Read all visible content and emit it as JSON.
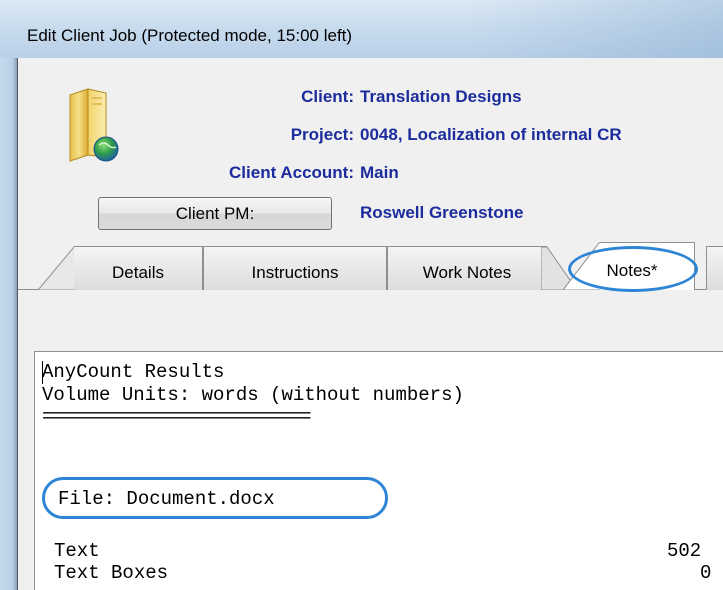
{
  "window": {
    "title": "Edit Client Job (Protected mode, 15:00 left)"
  },
  "header": {
    "icon": "folder-globe-icon",
    "client_label": "Client:",
    "client_value": "Translation Designs",
    "project_label": "Project:",
    "project_value": "0048, Localization of internal CR",
    "account_label": "Client Account:",
    "account_value": "Main",
    "pm_button_label": "Client PM:",
    "pm_value": "Roswell Greenstone"
  },
  "tabs": [
    {
      "label": "Details",
      "active": false
    },
    {
      "label": "Instructions",
      "active": false
    },
    {
      "label": "Work Notes",
      "active": false
    },
    {
      "label": "Notes*",
      "active": true
    }
  ],
  "notes": {
    "line1": "AnyCount Results",
    "line2": "Volume Units: words (without numbers)",
    "separator": "==============================",
    "file_line": "File: Document.docx",
    "rows": [
      {
        "label": "Text",
        "value": "502"
      },
      {
        "label": "Text Boxes",
        "value": "0"
      }
    ]
  },
  "colors": {
    "label_blue": "#1c2c9c",
    "highlight_ring": "#2e85d6"
  }
}
